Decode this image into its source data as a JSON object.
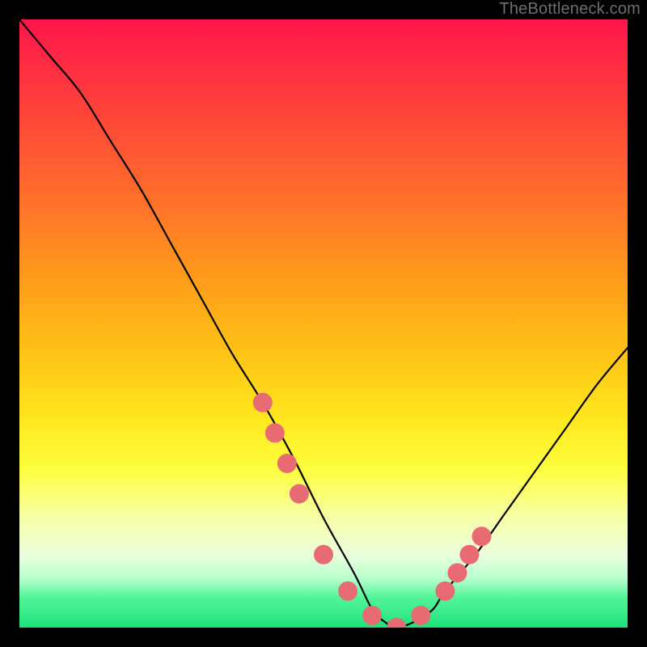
{
  "watermark": "TheBottleneck.com",
  "chart_data": {
    "type": "line",
    "title": "",
    "xlabel": "",
    "ylabel": "",
    "xlim": [
      0,
      100
    ],
    "ylim": [
      0,
      100
    ],
    "grid": false,
    "legend": false,
    "series": [
      {
        "name": "bottleneck-curve",
        "x": [
          0,
          5,
          10,
          15,
          20,
          25,
          30,
          35,
          40,
          45,
          50,
          55,
          58,
          60,
          62,
          65,
          68,
          70,
          75,
          80,
          85,
          90,
          95,
          100
        ],
        "values": [
          100,
          94,
          88,
          80,
          72,
          63,
          54,
          45,
          37,
          28,
          18,
          9,
          3,
          1,
          0,
          1,
          3,
          6,
          12,
          19,
          26,
          33,
          40,
          46
        ]
      }
    ],
    "markers": {
      "name": "highlighted-points",
      "x": [
        40,
        42,
        44,
        46,
        50,
        54,
        58,
        62,
        66,
        70,
        72,
        74,
        76
      ],
      "values": [
        37,
        32,
        27,
        22,
        12,
        6,
        2,
        0,
        2,
        6,
        9,
        12,
        15
      ],
      "color": "#e86a72",
      "size": 12
    },
    "background_gradient": {
      "top": "#ff154a",
      "bottom": "#1ee27b",
      "stops": [
        "#ff154a",
        "#ff3a3d",
        "#ff6a2c",
        "#ff9a1c",
        "#ffc316",
        "#ffe81e",
        "#fdff3e",
        "#f7ffa8",
        "#ecffde",
        "#b6ffcd",
        "#54f59a",
        "#1ee27b"
      ]
    }
  }
}
